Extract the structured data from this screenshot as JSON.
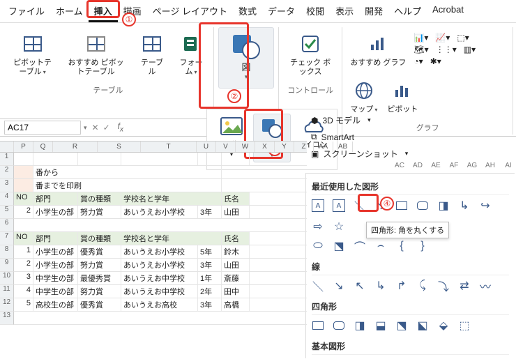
{
  "menubar": [
    "ファイル",
    "ホーム",
    "挿入",
    "描画",
    "ページ レイアウト",
    "数式",
    "データ",
    "校閲",
    "表示",
    "開発",
    "ヘルプ",
    "Acrobat"
  ],
  "active_menu_index": 2,
  "ribbon": {
    "tables_group": {
      "label": "テーブル",
      "pivot": "ピボットテーブル",
      "recommended_pivot": "おすすめ ピボットテーブル",
      "table": "テーブル",
      "form": "フォーム"
    },
    "zu_big_label": "図",
    "controls_group": {
      "checkbox": "チェック ボックス",
      "label": "コントロール"
    },
    "charts_group": {
      "label": "グラフ",
      "recommended": "おすすめ グラフ",
      "map": "マップ",
      "pivot_chart": "ピボット"
    }
  },
  "sub_panel": {
    "image": "画像",
    "shapes": "図形",
    "icon": "アイコン"
  },
  "right_menu": {
    "threeD": "3D モデル",
    "smartart": "SmartArt",
    "screenshot": "スクリーンショット"
  },
  "gallery": {
    "recent": "最近使用した図形",
    "lines": "線",
    "rects": "四角形",
    "basic": "基本図形",
    "tooltip": "四角形: 角を丸くする"
  },
  "formula_bar": {
    "name": "AC17"
  },
  "col_headers": [
    "",
    "P",
    "Q",
    "R",
    "S",
    "T",
    "U",
    "V",
    "W",
    "X",
    "Y",
    "Z",
    "AA",
    "AB"
  ],
  "col_headers2": [
    "AC",
    "AD",
    "AE",
    "AF",
    "AG",
    "AH",
    "AI"
  ],
  "sheet": {
    "text1": "番から",
    "text2": "番までを印刷",
    "hdr": {
      "no": "NO",
      "bu": "部門",
      "sh": "賞の種類",
      "sc": "学校名と学年",
      "nm": "氏名"
    },
    "row_a": {
      "no": "2",
      "bu": "小学生の部",
      "sh": "努力賞",
      "sc": "あいうえお小学校",
      "yr": "3年",
      "nm": "山田"
    },
    "rows": [
      {
        "no": "1",
        "bu": "小学生の部",
        "sh": "優秀賞",
        "sc": "あいうえお小学校",
        "yr": "5年",
        "nm": "鈴木"
      },
      {
        "no": "2",
        "bu": "小学生の部",
        "sh": "努力賞",
        "sc": "あいうえお小学校",
        "yr": "3年",
        "nm": "山田"
      },
      {
        "no": "3",
        "bu": "中学生の部",
        "sh": "最優秀賞",
        "sc": "あいうえお中学校",
        "yr": "1年",
        "nm": "斎藤"
      },
      {
        "no": "4",
        "bu": "中学生の部",
        "sh": "努力賞",
        "sc": "あいうえお中学校",
        "yr": "2年",
        "nm": "田中"
      },
      {
        "no": "5",
        "bu": "高校生の部",
        "sh": "優秀賞",
        "sc": "あいうえお高校",
        "yr": "3年",
        "nm": "高橋"
      }
    ]
  },
  "badges": [
    "①",
    "②",
    "③",
    "④"
  ]
}
